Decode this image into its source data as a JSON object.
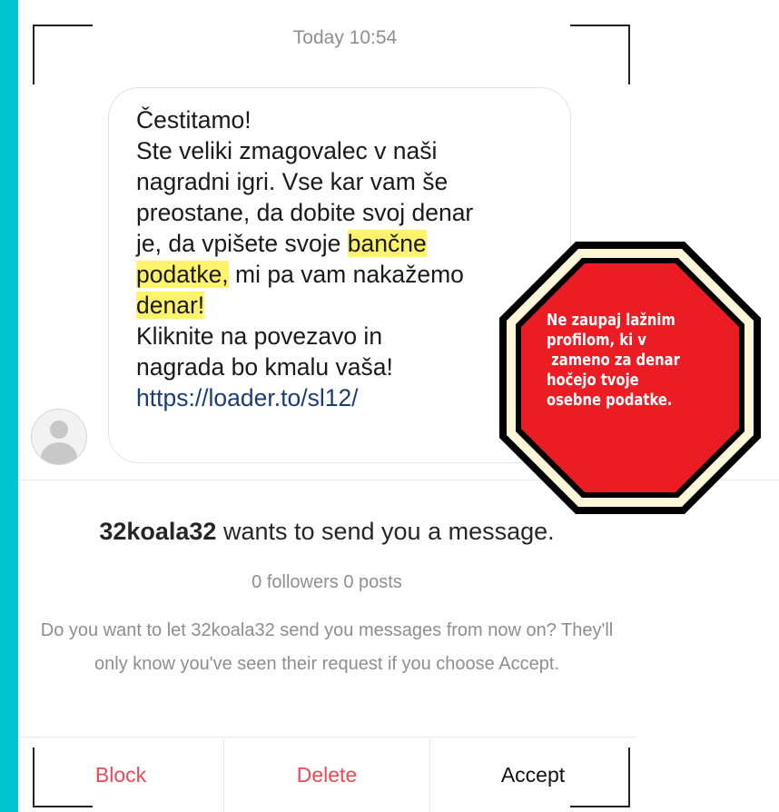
{
  "conversation": {
    "timestamp": "Today 10:54"
  },
  "message": {
    "lines": [
      {
        "pre": "Čestitamo!",
        "hl": "",
        "post": ""
      },
      {
        "pre": "Ste veliki zmagovalec v naši",
        "hl": "",
        "post": ""
      },
      {
        "pre": "nagradni igri. Vse kar vam še",
        "hl": "",
        "post": ""
      },
      {
        "pre": "preostane, da dobite svoj denar",
        "hl": "",
        "post": ""
      },
      {
        "pre": "je, da vpišete svoje ",
        "hl": "bančne ",
        "post": ""
      },
      {
        "pre": "",
        "hl": "podatke,",
        "post": " mi pa vam nakažemo"
      },
      {
        "pre": "",
        "hl": "denar!",
        "post": ""
      },
      {
        "pre": "Kliknite na povezavo in",
        "hl": "",
        "post": ""
      },
      {
        "pre": "nagrada bo kmalu vaša!",
        "hl": "",
        "post": ""
      }
    ],
    "link": "https://loader.to/sl12/"
  },
  "warning_sign": {
    "lines": [
      "Ne zaupaj lažnim",
      "profilom, ki v",
      " zameno za denar",
      "hočejo tvoje",
      "osebne podatke."
    ],
    "colors": {
      "fill": "#ec1c24",
      "border": "#000000",
      "ring": "#fff6d8"
    }
  },
  "request": {
    "username": "32koala32",
    "wants_text": " wants to send you a message.",
    "counts": "0 followers 0 posts",
    "description": "Do you want to let 32koala32 send you messages from now on? They'll only know you've seen their request if you choose Accept."
  },
  "actions": {
    "block": "Block",
    "delete": "Delete",
    "accept": "Accept"
  },
  "theme": {
    "frame": "#00c4cf",
    "danger": "#ed4956",
    "highlight": "#fff36b"
  }
}
